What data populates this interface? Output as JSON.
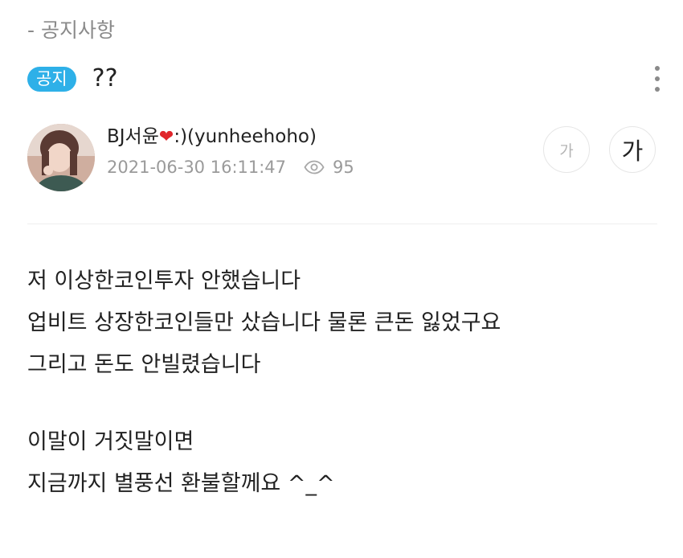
{
  "breadcrumb": "- 공지사항",
  "post": {
    "badge": "공지",
    "title": "??"
  },
  "author": {
    "name_prefix": "BJ서윤",
    "name_suffix": ":)(yunheehoho)",
    "heart_icon": "heart-icon",
    "datetime": "2021-06-30 16:11:47",
    "views": "95"
  },
  "font_controls": {
    "small_label": "가",
    "large_label": "가"
  },
  "content": {
    "lines": [
      "저 이상한코인투자 안했습니다",
      "업비트 상장한코인들만 샀습니다 물론 큰돈 잃었구요",
      "그리고 돈도 안빌렸습니다",
      "",
      "이말이 거짓말이면",
      "지금까지 별풍선 환불할께요 ^_^"
    ]
  },
  "colors": {
    "badge": "#2eb0e8",
    "heart": "#e0262b",
    "muted_text": "#9a9a9a"
  }
}
